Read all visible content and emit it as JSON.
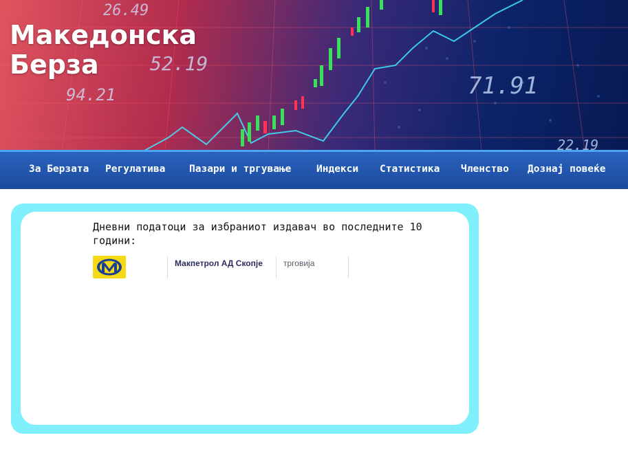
{
  "site": {
    "title_line1": "Македонска",
    "title_line2": "Берза"
  },
  "hero": {
    "ticker_values": [
      "52.19",
      "94.21",
      "71.91",
      "26.49",
      "22.19"
    ]
  },
  "nav": {
    "items": [
      {
        "label": "За Берзата"
      },
      {
        "label": "Регулатива"
      },
      {
        "label": "Пазари и тргување"
      },
      {
        "label": "Индекси"
      },
      {
        "label": "Статистика"
      },
      {
        "label": "Членство"
      },
      {
        "label": "Дознај повеќе"
      }
    ]
  },
  "panel": {
    "title": "Дневни податоци за избраниот издавач во последните 10 години:",
    "issuer": {
      "name": "Макпетрол АД Скопје",
      "sector": "трговија",
      "logo_icon": "makpetrol-logo-icon"
    }
  },
  "colors": {
    "nav_background": "#1b4b9e",
    "nav_accent": "#4aa5f2",
    "panel_border": "#7eeffb",
    "logo_yellow": "#f5d816",
    "logo_blue": "#1a3f8f"
  }
}
